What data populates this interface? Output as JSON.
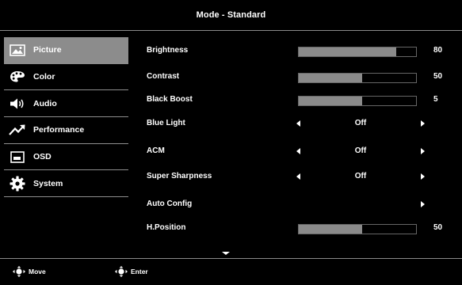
{
  "header": {
    "title": "Mode - Standard"
  },
  "sidebar": {
    "items": [
      {
        "label": "Picture",
        "icon": "picture-icon",
        "active": true
      },
      {
        "label": "Color",
        "icon": "palette-icon",
        "active": false
      },
      {
        "label": "Audio",
        "icon": "speaker-icon",
        "active": false
      },
      {
        "label": "Performance",
        "icon": "trend-up-icon",
        "active": false
      },
      {
        "label": "OSD",
        "icon": "osd-icon",
        "active": false
      },
      {
        "label": "System",
        "icon": "gear-icon",
        "active": false
      }
    ]
  },
  "settings": {
    "brightness": {
      "label": "Brightness",
      "value": "80",
      "level": 0.83
    },
    "contrast": {
      "label": "Contrast",
      "value": "50",
      "level": 0.54
    },
    "black_boost": {
      "label": "Black Boost",
      "value": "5",
      "level": 0.54
    },
    "blue_light": {
      "label": "Blue Light",
      "value": "Off"
    },
    "acm": {
      "label": "ACM",
      "value": "Off"
    },
    "super_sharpness": {
      "label": "Super Sharpness",
      "value": "Off"
    },
    "auto_config": {
      "label": "Auto Config"
    },
    "h_position": {
      "label": "H.Position",
      "value": "50",
      "level": 0.54
    }
  },
  "footer": {
    "move_label": "Move",
    "enter_label": "Enter"
  },
  "colors": {
    "background": "#000000",
    "highlight": "#8c8c8c",
    "bar_fill": "#8a8a8a",
    "text": "#ffffff"
  }
}
